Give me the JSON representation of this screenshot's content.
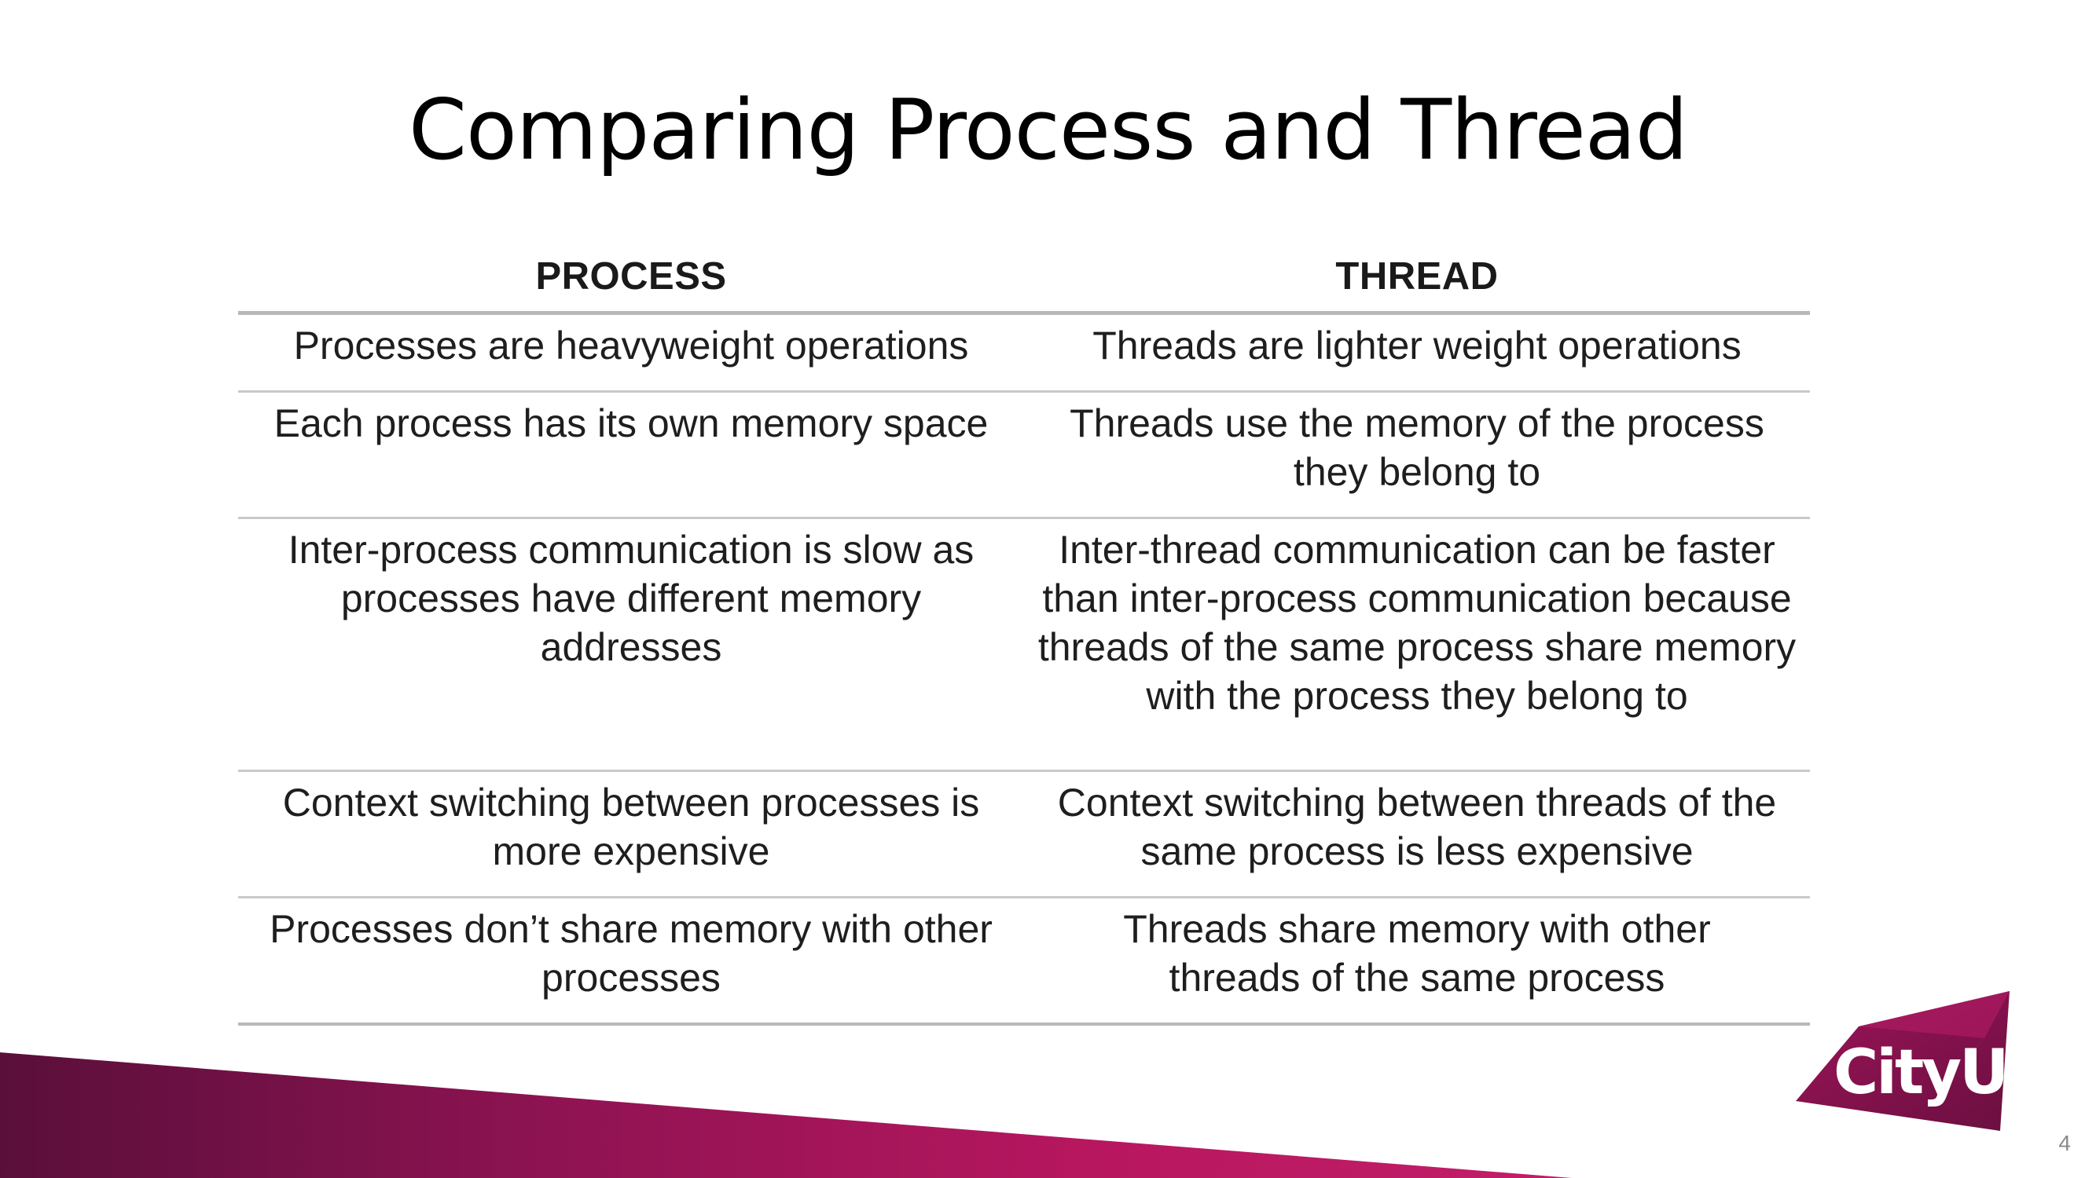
{
  "slide": {
    "title": "Comparing Process and Thread",
    "page_number": "4"
  },
  "table": {
    "headers": [
      "PROCESS",
      "THREAD"
    ],
    "rows": [
      [
        "Processes are heavyweight operations",
        "Threads are lighter weight operations"
      ],
      [
        "Each process has its own memory space",
        "Threads use the memory of the process they belong to"
      ],
      [
        "Inter-process communication is slow as processes have different memory addresses",
        "Inter-thread communication can be faster than inter-process communication because threads of the same process share memory with the process they belong to"
      ],
      [
        "Context switching between processes is more expensive",
        "Context switching between threads of the same process is less expensive"
      ],
      [
        "Processes don’t share memory with other processes",
        "Threads share memory with other threads of the same process"
      ]
    ]
  },
  "logo": {
    "text": "CityU"
  },
  "colors": {
    "brand_dark": "#5a0f3a",
    "brand": "#a1155a",
    "brand_light": "#c01f6c",
    "rule": "#b8b8b8"
  }
}
